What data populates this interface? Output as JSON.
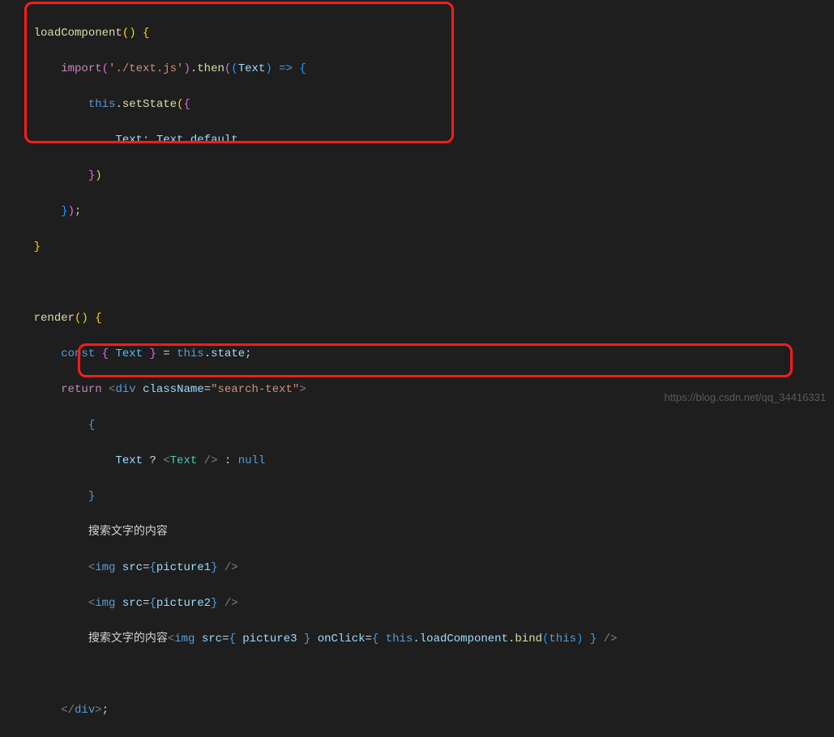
{
  "code": {
    "l1_fn": "loadComponent",
    "l1_paren": "() {",
    "l2_import": "import",
    "l2_str": "'./text.js'",
    "l2_then": ".then",
    "l2_arrow_open": "((",
    "l2_param": "Text",
    "l2_arrow_close": ") => {",
    "l3_this": "this",
    "l3_dot": ".",
    "l3_setstate": "setState",
    "l3_open": "({",
    "l4_key": "Text",
    "l4_colon": ": ",
    "l4_val": "Text",
    "l4_default": ".default",
    "l5_close": "})",
    "l6_close": "});",
    "l7_close": "}",
    "l9_render": "render",
    "l9_paren": "() {",
    "l10_const": "const",
    "l10_destr_open": " { ",
    "l10_text": "Text",
    "l10_destr_close": " } = ",
    "l10_this": "this",
    "l10_state": ".state",
    "l10_semi": ";",
    "l11_return": "return",
    "l11_div_open": " <",
    "l11_div": "div",
    "l11_classname": " className",
    "l11_eq": "=",
    "l11_classval": "\"search-text\"",
    "l11_close": ">",
    "l12_open": "{",
    "l13_text": "Text",
    "l13_q": " ? ",
    "l13_tag_open": "<",
    "l13_tagname": "Text",
    "l13_tag_close": " />",
    "l13_colon": " : ",
    "l13_null": "null",
    "l14_close": "}",
    "l15_cn": "搜索文字的内容",
    "l16_img": "img",
    "l16_src": " src",
    "l16_eq": "=",
    "l16_val_open": "{",
    "l16_pic": "picture1",
    "l16_val_close": "}",
    "l16_end": " />",
    "l17_pic": "picture2",
    "l18_cn": "搜索文字的内容",
    "l18_pic": "picture3",
    "l18_onclick": " onClick",
    "l18_this": "this",
    "l18_load": ".loadComponent.",
    "l18_bind": "bind",
    "l18_this2": "this",
    "l20_divclose": "div",
    "l20_semi": ";"
  },
  "watermark": "https://blog.csdn.net/qq_34416331"
}
